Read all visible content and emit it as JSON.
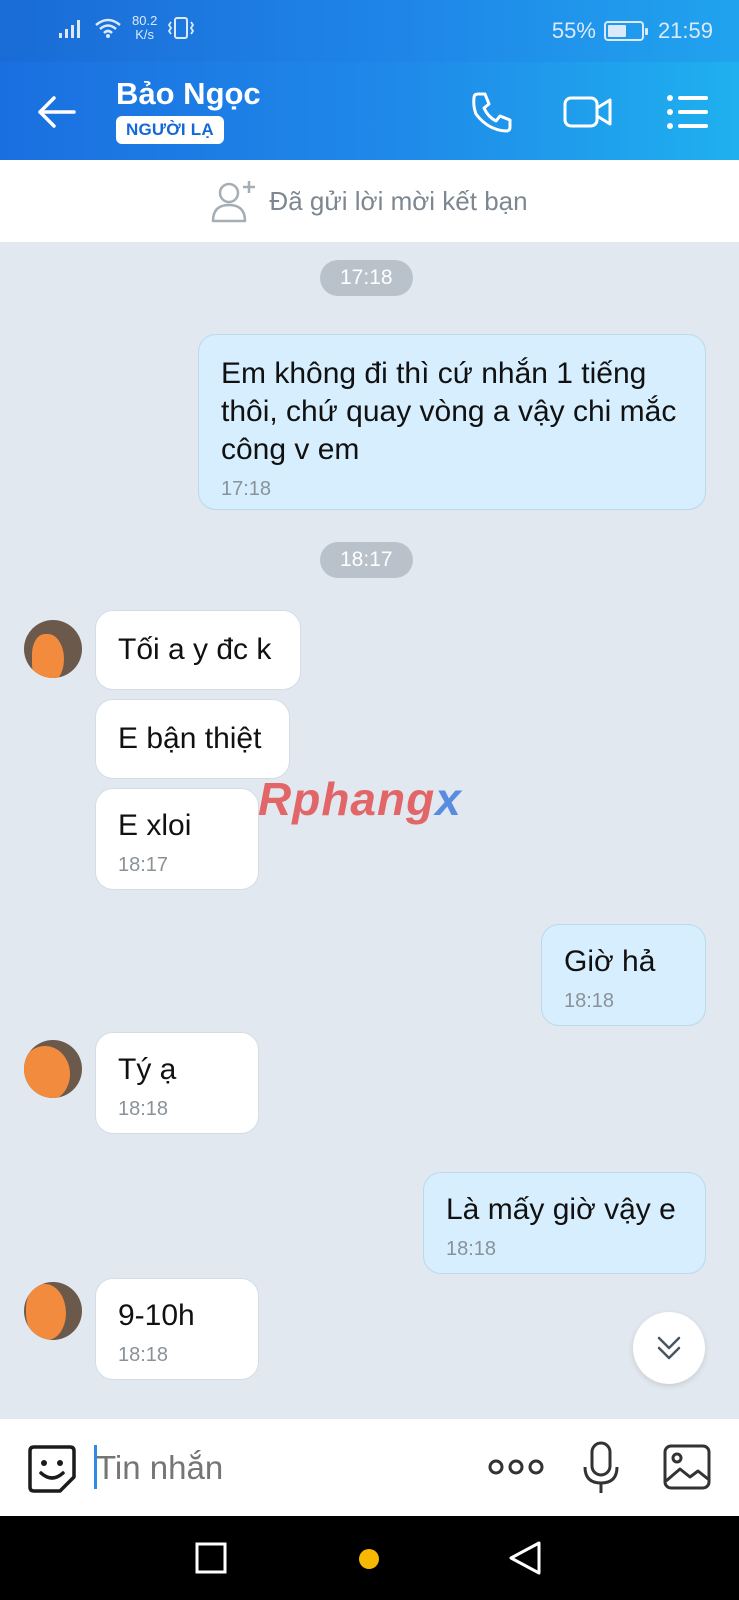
{
  "status_bar": {
    "net_speed_value": "80.2",
    "net_speed_unit": "K/s",
    "battery": "55%",
    "time": "21:59",
    "battery_level": 0.55
  },
  "header": {
    "contact_name": "Bảo Ngọc",
    "badge": "NGƯỜI LẠ"
  },
  "friend_request": {
    "text": "Đã gửi lời mời kết bạn"
  },
  "chat": {
    "time_dividers": [
      "17:18",
      "18:17"
    ],
    "messages": [
      {
        "dir": "out",
        "text": "Em không đi thì cứ nhắn 1 tiếng thôi, chứ quay vòng a vậy chi mắc công v em",
        "time": "17:18"
      },
      {
        "dir": "in",
        "text": "Tối a y đc k"
      },
      {
        "dir": "in",
        "text": "E bận thiệt"
      },
      {
        "dir": "in",
        "text": "E xloi",
        "time": "18:17"
      },
      {
        "dir": "out",
        "text": "Giờ hả",
        "time": "18:18"
      },
      {
        "dir": "in",
        "text": "Tý ạ",
        "time": "18:18"
      },
      {
        "dir": "out",
        "text": "Là mấy giờ vậy e",
        "time": "18:18"
      },
      {
        "dir": "in",
        "text": "9-10h",
        "time": "18:18"
      }
    ]
  },
  "watermark": {
    "part1": "Rphang",
    "part2": "x"
  },
  "input": {
    "placeholder": "Tin nhắn"
  },
  "icons": {
    "back": "arrow-left-icon",
    "call": "phone-icon",
    "video": "video-camera-icon",
    "menu": "list-menu-icon",
    "emoji": "sticker-icon",
    "more": "more-dots-icon",
    "mic": "microphone-icon",
    "image": "image-icon"
  },
  "colors": {
    "header_start": "#1a6fe0",
    "header_end": "#1fb0ef",
    "outgoing_bubble": "#d6eefd",
    "chat_background": "#e1e8ef"
  }
}
